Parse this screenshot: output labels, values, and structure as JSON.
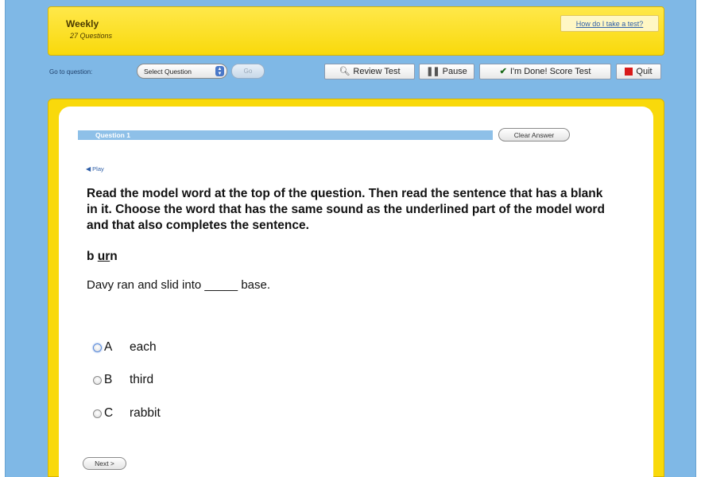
{
  "header": {
    "title": "Weekly",
    "question_count": "27 Questions",
    "help_link": "How do I take a test?"
  },
  "toolbar": {
    "go_label": "Go to question:",
    "select_value": "Select Question",
    "go_button": "Go",
    "review_button": "Review Test",
    "pause_button": "Pause",
    "done_button": "I'm Done! Score Test",
    "quit_button": "Quit"
  },
  "question": {
    "number_label": "Question 1",
    "clear_button": "Clear Answer",
    "play_label": "Play",
    "prompt": "Read the model word at the top of the question. Then read the sentence that has a blank in it. Choose the word that has the same sound as the underlined part of the model word and that also completes the sentence.",
    "model_word": {
      "before": "b",
      "underlined": "ur",
      "after": "n"
    },
    "sentence_before": "Davy ran and slid into",
    "blank": "_____",
    "sentence_after": "base.",
    "choices": [
      {
        "letter": "A",
        "text": "each"
      },
      {
        "letter": "B",
        "text": "third"
      },
      {
        "letter": "C",
        "text": "rabbit"
      }
    ],
    "next_button": "Next >"
  },
  "colors": {
    "background": "#7fb8e6",
    "banner_yellow": "#f9d90b",
    "question_bar": "#8ec0e8",
    "link_blue": "#2f5fa8",
    "quit_red": "#d81a1a"
  }
}
